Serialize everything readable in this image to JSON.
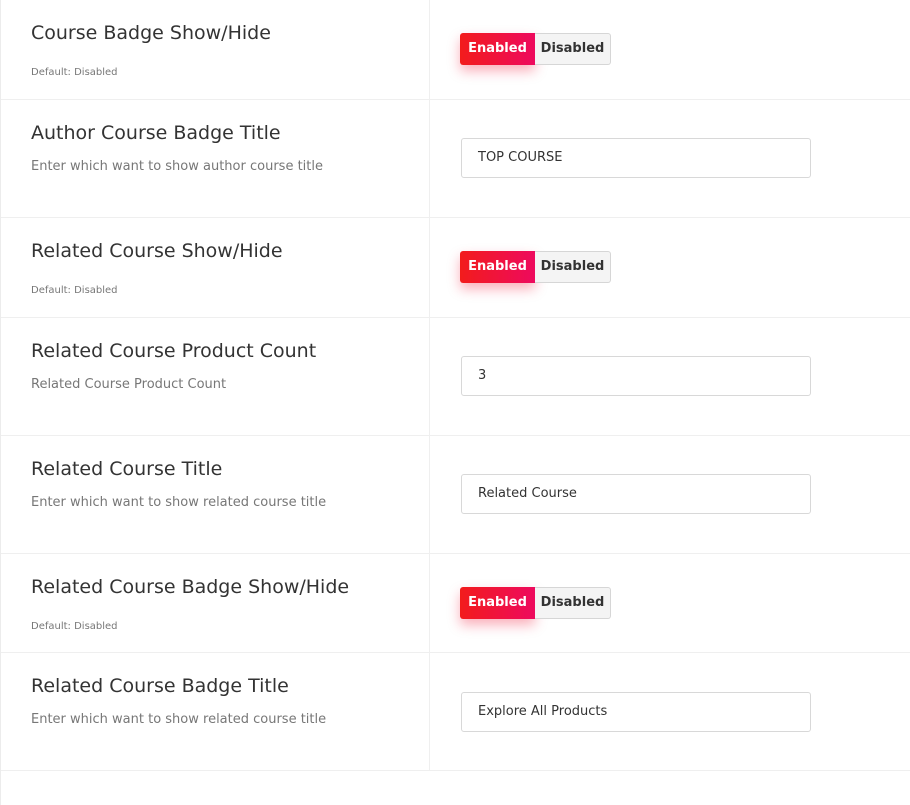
{
  "settings": [
    {
      "type": "toggle",
      "title": "Course Badge Show/Hide",
      "note": "Default: Disabled",
      "enabled_label": "Enabled",
      "disabled_label": "Disabled"
    },
    {
      "type": "input",
      "title": "Author Course Badge Title",
      "description": "Enter which want to show author course title",
      "value": "TOP COURSE"
    },
    {
      "type": "toggle",
      "title": "Related Course Show/Hide",
      "note": "Default: Disabled",
      "enabled_label": "Enabled",
      "disabled_label": "Disabled"
    },
    {
      "type": "input",
      "title": "Related Course Product Count",
      "description": "Related Course Product Count",
      "value": "3"
    },
    {
      "type": "input",
      "title": "Related Course Title",
      "description": "Enter which want to show related course title",
      "value": "Related Course"
    },
    {
      "type": "toggle",
      "title": "Related Course Badge Show/Hide",
      "note": "Default: Disabled",
      "enabled_label": "Enabled",
      "disabled_label": "Disabled"
    },
    {
      "type": "input",
      "title": "Related Course Badge Title",
      "description": "Enter which want to show related course title",
      "value": "Explore All Products"
    }
  ],
  "colors": {
    "accent_start": "#f21c1c",
    "accent_end": "#ee0a5e"
  }
}
